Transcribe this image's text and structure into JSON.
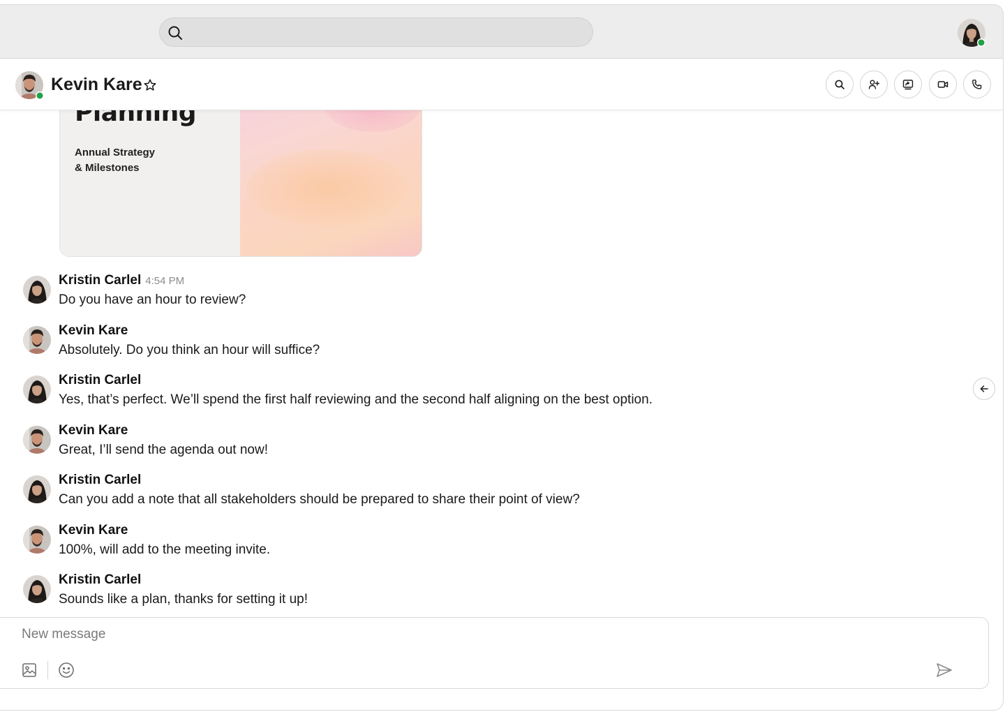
{
  "search": {
    "placeholder": "",
    "icon": "search-icon"
  },
  "current_user": {
    "status": "online",
    "status_color": "#22a14a"
  },
  "conversation": {
    "contact_name": "Kevin Kare",
    "contact_status": "online",
    "actions": [
      {
        "name": "search-in-chat-button",
        "icon": "search-icon"
      },
      {
        "name": "add-people-button",
        "icon": "person-plus-icon"
      },
      {
        "name": "share-screen-button",
        "icon": "share-screen-icon"
      },
      {
        "name": "video-call-button",
        "icon": "video-camera-icon"
      },
      {
        "name": "audio-call-button",
        "icon": "phone-icon"
      }
    ]
  },
  "shared_card": {
    "title": "Planning",
    "subtitle_line1": "Annual Strategy",
    "subtitle_line2": "& Milestones"
  },
  "messages": [
    {
      "sender": "Kristin Carlel",
      "time": "4:54 PM",
      "text": "Do you have an hour to review?"
    },
    {
      "sender": "Kevin Kare",
      "time": "",
      "text": "Absolutely. Do you think an hour will suffice?"
    },
    {
      "sender": "Kristin Carlel",
      "time": "",
      "text": "Yes, that’s perfect. We’ll spend the first half reviewing and the second half aligning on the best option."
    },
    {
      "sender": "Kevin Kare",
      "time": "",
      "text": "Great, I’ll send the agenda out now!"
    },
    {
      "sender": "Kristin Carlel",
      "time": "",
      "text": "Can you add a note that all stakeholders should be prepared to share their point of view?"
    },
    {
      "sender": "Kevin Kare",
      "time": "",
      "text": "100%, will add to the meeting invite."
    },
    {
      "sender": "Kristin Carlel",
      "time": "",
      "text": "Sounds like a plan, thanks for setting it up!"
    }
  ],
  "composer": {
    "placeholder": "New message",
    "value": ""
  },
  "colors": {
    "online": "#22a14a",
    "topbar_bg": "#ededed",
    "timestamp": "#8c8c8c"
  }
}
